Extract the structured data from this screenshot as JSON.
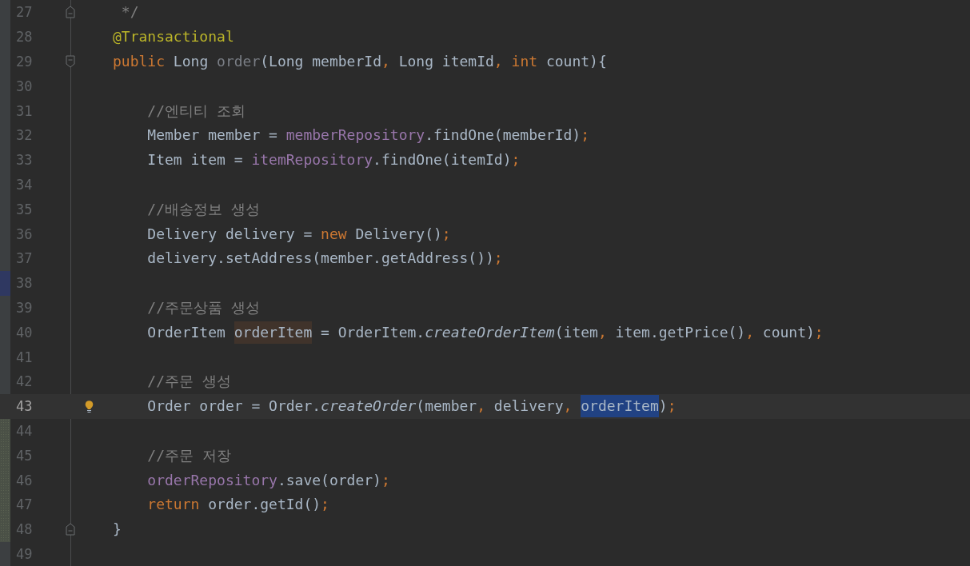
{
  "editor": {
    "lines": [
      {
        "number": "27",
        "fold_close": true,
        "tokens": [
          {
            "kind": "comment",
            "text": " */"
          }
        ]
      },
      {
        "number": "28",
        "tokens": [
          {
            "kind": "annotation",
            "text": "@Transactional"
          }
        ]
      },
      {
        "number": "29",
        "fold_open": true,
        "tokens": [
          {
            "kind": "keyword",
            "text": "public"
          },
          {
            "kind": "plain",
            "text": " Long "
          },
          {
            "kind": "unused",
            "text": "order"
          },
          {
            "kind": "plain",
            "text": "(Long memberId"
          },
          {
            "kind": "keyword",
            "text": ","
          },
          {
            "kind": "plain",
            "text": " Long itemId"
          },
          {
            "kind": "keyword",
            "text": ", "
          },
          {
            "kind": "keyword",
            "text": "int"
          },
          {
            "kind": "plain",
            "text": " count){"
          }
        ]
      },
      {
        "number": "30"
      },
      {
        "number": "31",
        "tokens": [
          {
            "kind": "comment",
            "text": "    //엔티티 조회"
          }
        ]
      },
      {
        "number": "32",
        "tokens": [
          {
            "kind": "plain",
            "text": "    Member member = "
          },
          {
            "kind": "field",
            "text": "memberRepository"
          },
          {
            "kind": "plain",
            "text": ".findOne(memberId)"
          },
          {
            "kind": "keyword",
            "text": ";"
          }
        ]
      },
      {
        "number": "33",
        "tokens": [
          {
            "kind": "plain",
            "text": "    Item item = "
          },
          {
            "kind": "field",
            "text": "itemRepository"
          },
          {
            "kind": "plain",
            "text": ".findOne(itemId)"
          },
          {
            "kind": "keyword",
            "text": ";"
          }
        ]
      },
      {
        "number": "34"
      },
      {
        "number": "35",
        "tokens": [
          {
            "kind": "comment",
            "text": "    //배송정보 생성"
          }
        ]
      },
      {
        "number": "36",
        "tokens": [
          {
            "kind": "plain",
            "text": "    Delivery delivery = "
          },
          {
            "kind": "keyword",
            "text": "new"
          },
          {
            "kind": "plain",
            "text": " Delivery()"
          },
          {
            "kind": "keyword",
            "text": ";"
          }
        ]
      },
      {
        "number": "37",
        "tokens": [
          {
            "kind": "plain",
            "text": "    delivery.setAddress(member.getAddress())"
          },
          {
            "kind": "keyword",
            "text": ";"
          }
        ]
      },
      {
        "number": "38",
        "bookmarked": true
      },
      {
        "number": "39",
        "tokens": [
          {
            "kind": "comment",
            "text": "    //주문상품 생성"
          }
        ]
      },
      {
        "number": "40",
        "tokens": [
          {
            "kind": "plain",
            "text": "    OrderItem "
          },
          {
            "kind": "plain",
            "text": "orderItem",
            "highlighted": true
          },
          {
            "kind": "plain",
            "text": " = OrderItem."
          },
          {
            "kind": "static",
            "text": "createOrderItem"
          },
          {
            "kind": "plain",
            "text": "(item"
          },
          {
            "kind": "keyword",
            "text": ","
          },
          {
            "kind": "plain",
            "text": " item.getPrice()"
          },
          {
            "kind": "keyword",
            "text": ","
          },
          {
            "kind": "plain",
            "text": " count)"
          },
          {
            "kind": "keyword",
            "text": ";"
          }
        ]
      },
      {
        "number": "41"
      },
      {
        "number": "42",
        "tokens": [
          {
            "kind": "comment",
            "text": "    //주문 생성"
          }
        ]
      },
      {
        "number": "43",
        "current": true,
        "bulb": true,
        "tokens": [
          {
            "kind": "plain",
            "text": "    Order order = Order."
          },
          {
            "kind": "static",
            "text": "createOrder"
          },
          {
            "kind": "plain",
            "text": "(member"
          },
          {
            "kind": "keyword",
            "text": ","
          },
          {
            "kind": "plain",
            "text": " delivery"
          },
          {
            "kind": "keyword",
            "text": ", "
          },
          {
            "kind": "plain",
            "text": "orderItem",
            "selected": true
          },
          {
            "kind": "plain",
            "text": ")"
          },
          {
            "kind": "keyword",
            "text": ";"
          }
        ]
      },
      {
        "number": "44",
        "modified": true
      },
      {
        "number": "45",
        "modified": true,
        "tokens": [
          {
            "kind": "comment",
            "text": "    //주문 저장"
          }
        ]
      },
      {
        "number": "46",
        "modified": true,
        "tokens": [
          {
            "kind": "field",
            "text": "    orderRepository"
          },
          {
            "kind": "plain",
            "text": ".save(order)"
          },
          {
            "kind": "keyword",
            "text": ";"
          }
        ]
      },
      {
        "number": "47",
        "modified": true,
        "tokens": [
          {
            "kind": "keyword",
            "text": "    return"
          },
          {
            "kind": "plain",
            "text": " order.getId()"
          },
          {
            "kind": "keyword",
            "text": ";"
          }
        ]
      },
      {
        "number": "48",
        "modified": true,
        "fold_close": true,
        "tokens": [
          {
            "kind": "plain",
            "text": "}"
          }
        ]
      },
      {
        "number": "49"
      }
    ]
  }
}
